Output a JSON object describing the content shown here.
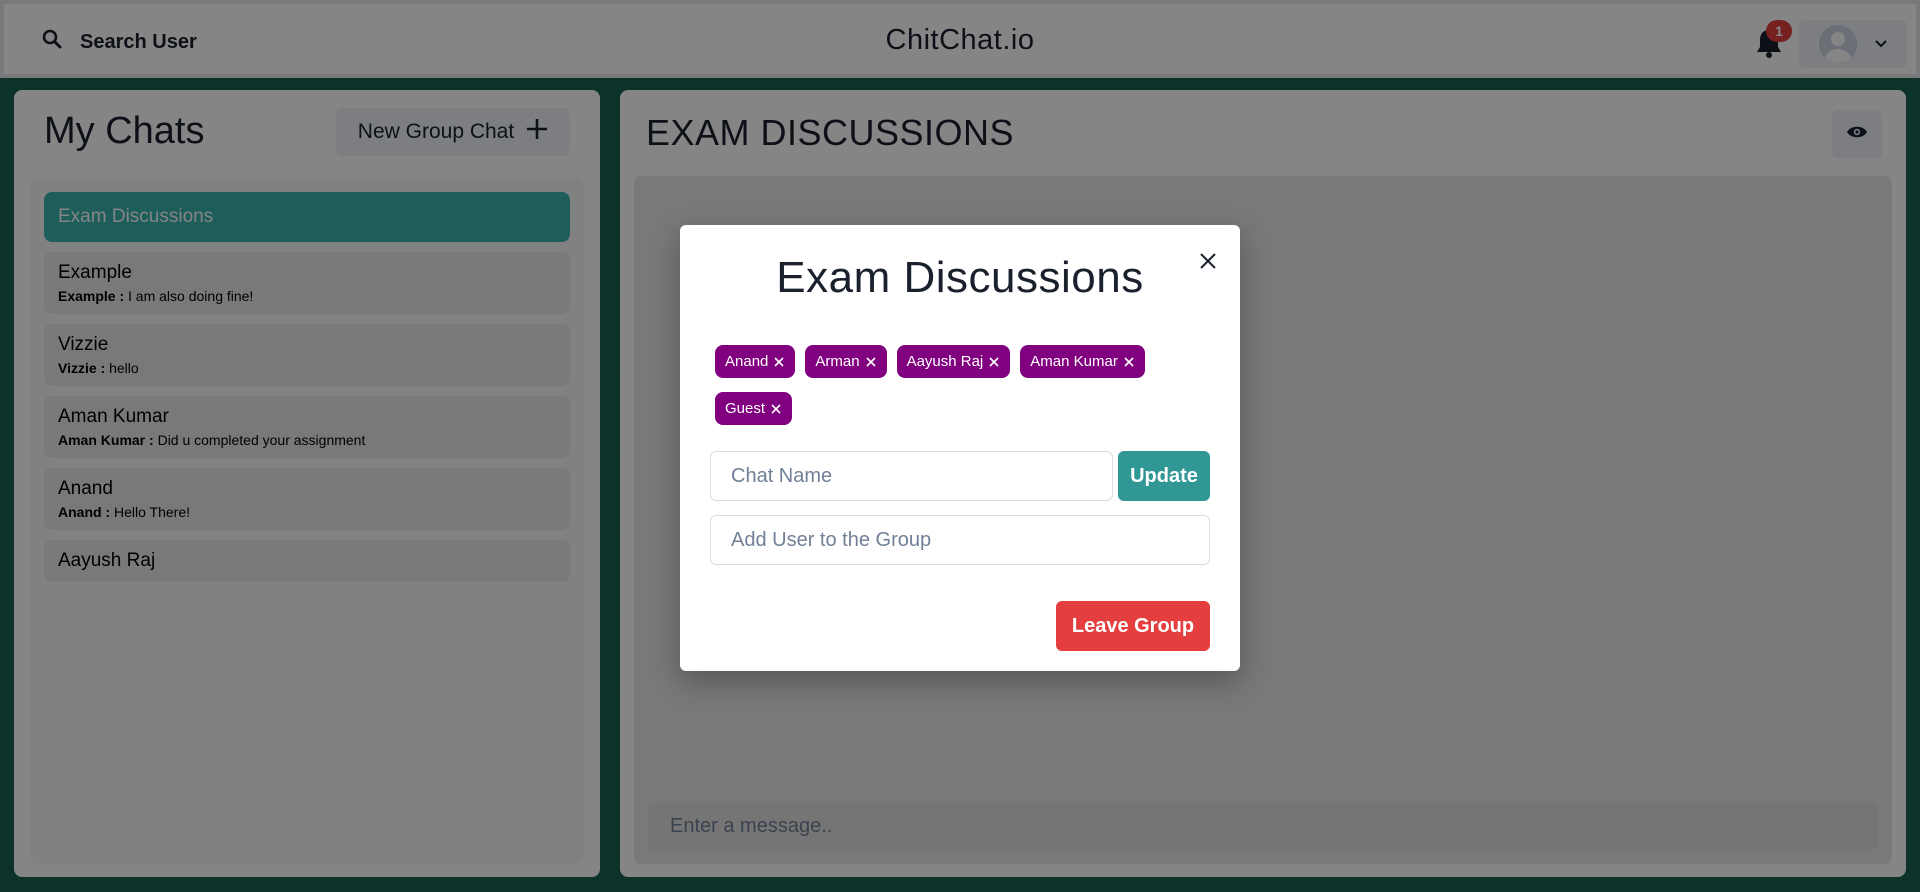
{
  "header": {
    "search_label": "Search User",
    "app_title": "ChitChat.io",
    "notification_count": "1"
  },
  "sidebar": {
    "title": "My Chats",
    "new_group_label": "New Group Chat",
    "chats": [
      {
        "name": "Exam Discussions",
        "sender": "",
        "message": "",
        "active": true
      },
      {
        "name": "Example",
        "sender": "Example :",
        "message": " I am also doing fine!"
      },
      {
        "name": "Vizzie",
        "sender": "Vizzie :",
        "message": " hello"
      },
      {
        "name": "Aman Kumar",
        "sender": "Aman Kumar :",
        "message": " Did u completed your assignment"
      },
      {
        "name": "Anand",
        "sender": "Anand :",
        "message": " Hello There!"
      },
      {
        "name": "Aayush Raj",
        "sender": "",
        "message": ""
      }
    ]
  },
  "chat": {
    "title": "EXAM DISCUSSIONS",
    "message_placeholder": "Enter a message.."
  },
  "modal": {
    "title": "Exam Discussions",
    "members": [
      "Anand",
      "Arman",
      "Aayush Raj",
      "Aman Kumar",
      "Guest"
    ],
    "chat_name_placeholder": "Chat Name",
    "update_label": "Update",
    "add_user_placeholder": "Add User to the Group",
    "leave_label": "Leave Group"
  },
  "colors": {
    "accent_teal": "#38b2ac",
    "chip_purple": "#800080",
    "danger_red": "#e53e3e"
  },
  "icons": {
    "search": "search-icon",
    "bell": "bell-icon",
    "chevron": "chevron-down-icon",
    "add": "plus-icon",
    "eye": "eye-icon",
    "close": "close-icon"
  }
}
